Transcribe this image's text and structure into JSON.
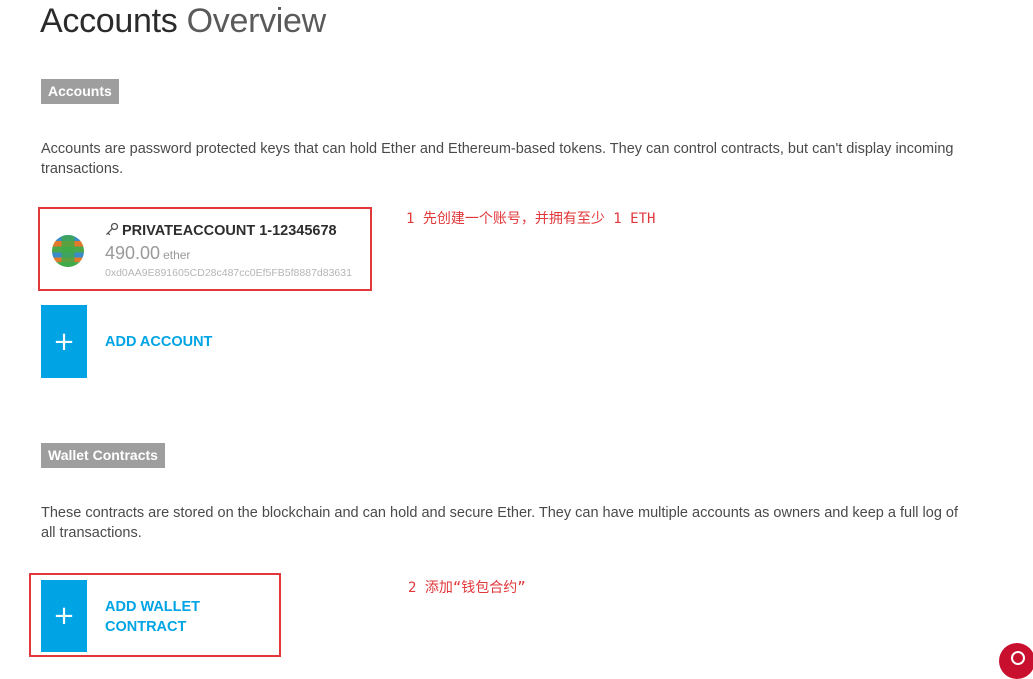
{
  "page": {
    "title_main": "Accounts",
    "title_light": "Overview"
  },
  "accounts_section": {
    "badge": "Accounts",
    "description": "Accounts are password protected keys that can hold Ether and Ethereum-based tokens. They can control contracts, but can't display incoming transactions.",
    "items": [
      {
        "name": "PRIVATEACCOUNT 1-12345678",
        "balance": "490.00",
        "unit": "ether",
        "address": "0xd0AA9E891605CD28c487cc0Ef5FB5f8887d83631",
        "icon": "key-icon"
      }
    ],
    "add_label": "ADD ACCOUNT",
    "add_icon": "+"
  },
  "wallet_section": {
    "badge": "Wallet Contracts",
    "description": "These contracts are stored on the blockchain and can hold and secure Ether. They can have multiple accounts as owners and keep a full log of all transactions.",
    "add_label_line1": "ADD WALLET",
    "add_label_line2": "CONTRACT",
    "add_icon": "+"
  },
  "annotations": {
    "note1": "1 先创建一个账号，并拥有至少 1 ETH",
    "note2": "2 添加“钱包合约”",
    "color": "#e0383b"
  },
  "colors": {
    "accent": "#00a4e4",
    "badge_bg": "#9e9e9e"
  }
}
